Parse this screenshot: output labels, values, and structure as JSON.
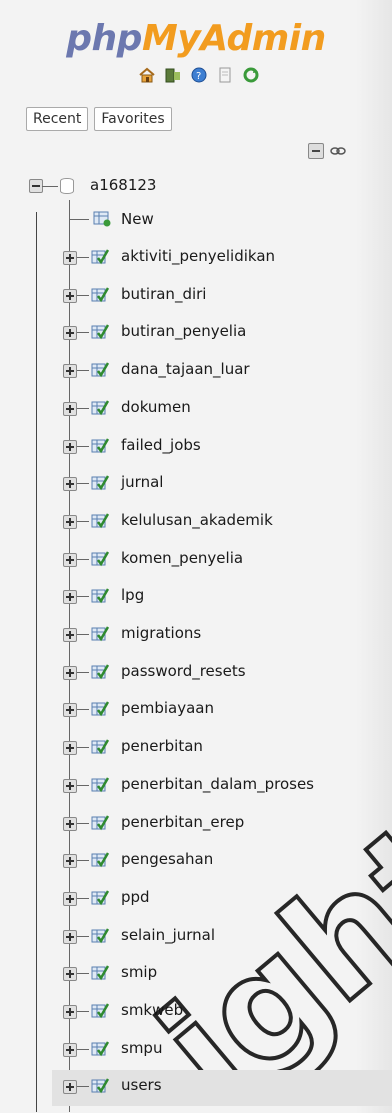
{
  "logo": {
    "part1": "php",
    "part2": "MyAdmin"
  },
  "toolbar_icons": [
    "home-icon",
    "exit-icon",
    "help-icon",
    "documentation-icon",
    "reload-icon"
  ],
  "tabs": {
    "recent": "Recent",
    "favorites": "Favorites"
  },
  "tree": {
    "database": "a168123",
    "new_label": "New",
    "tables": [
      "aktiviti_penyelidikan",
      "butiran_diri",
      "butiran_penyelia",
      "dana_tajaan_luar",
      "dokumen",
      "failed_jobs",
      "jurnal",
      "kelulusan_akademik",
      "komen_penyelia",
      "lpg",
      "migrations",
      "password_resets",
      "pembiayaan",
      "penerbitan",
      "penerbitan_dalam_proses",
      "penerbitan_erep",
      "pengesahan",
      "ppd",
      "selain_jurnal",
      "smip",
      "smkweb",
      "smpu",
      "users"
    ]
  },
  "colors": {
    "logo_php": "#6c78af",
    "logo_myadmin": "#f29c1f",
    "selected": "#e2e2e2"
  }
}
